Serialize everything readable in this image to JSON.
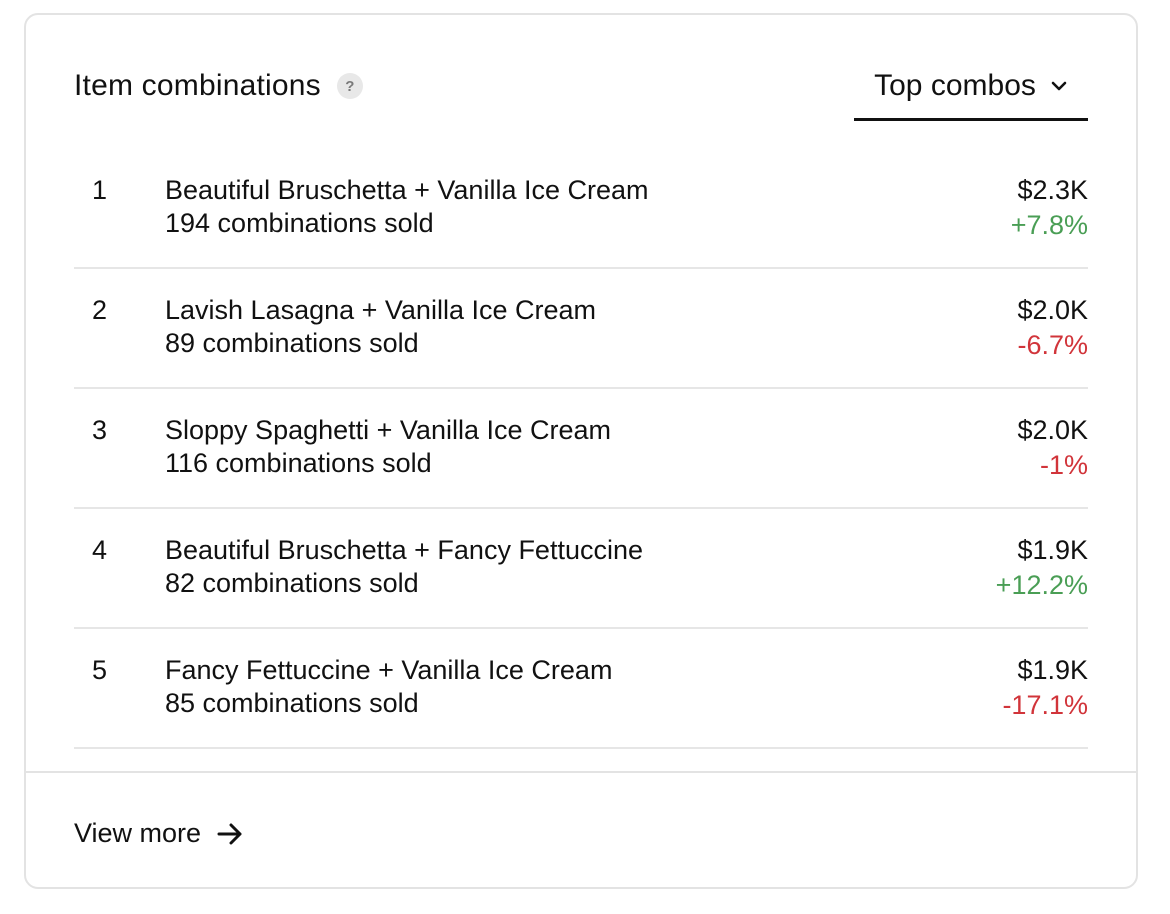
{
  "header": {
    "title": "Item combinations",
    "help_icon": "question-mark-icon",
    "dropdown_label": "Top combos",
    "dropdown_icon": "chevron-down-icon"
  },
  "combos": [
    {
      "rank": "1",
      "name": "Beautiful Bruschetta + Vanilla Ice Cream",
      "sold": "194 combinations sold",
      "revenue": "$2.3K",
      "change": "+7.8%",
      "trend": "positive"
    },
    {
      "rank": "2",
      "name": "Lavish Lasagna + Vanilla Ice Cream",
      "sold": "89 combinations sold",
      "revenue": "$2.0K",
      "change": "-6.7%",
      "trend": "negative"
    },
    {
      "rank": "3",
      "name": "Sloppy Spaghetti + Vanilla Ice Cream",
      "sold": "116 combinations sold",
      "revenue": "$2.0K",
      "change": "-1%",
      "trend": "negative"
    },
    {
      "rank": "4",
      "name": "Beautiful Bruschetta + Fancy Fettuccine",
      "sold": "82 combinations sold",
      "revenue": "$1.9K",
      "change": "+12.2%",
      "trend": "positive"
    },
    {
      "rank": "5",
      "name": "Fancy Fettuccine + Vanilla Ice Cream",
      "sold": "85 combinations sold",
      "revenue": "$1.9K",
      "change": "-17.1%",
      "trend": "negative"
    }
  ],
  "footer": {
    "view_more_label": "View more",
    "view_more_icon": "arrow-right-icon"
  },
  "colors": {
    "positive": "#4a9e55",
    "negative": "#d1343a",
    "text": "#111111",
    "border": "#e3e3e3"
  }
}
